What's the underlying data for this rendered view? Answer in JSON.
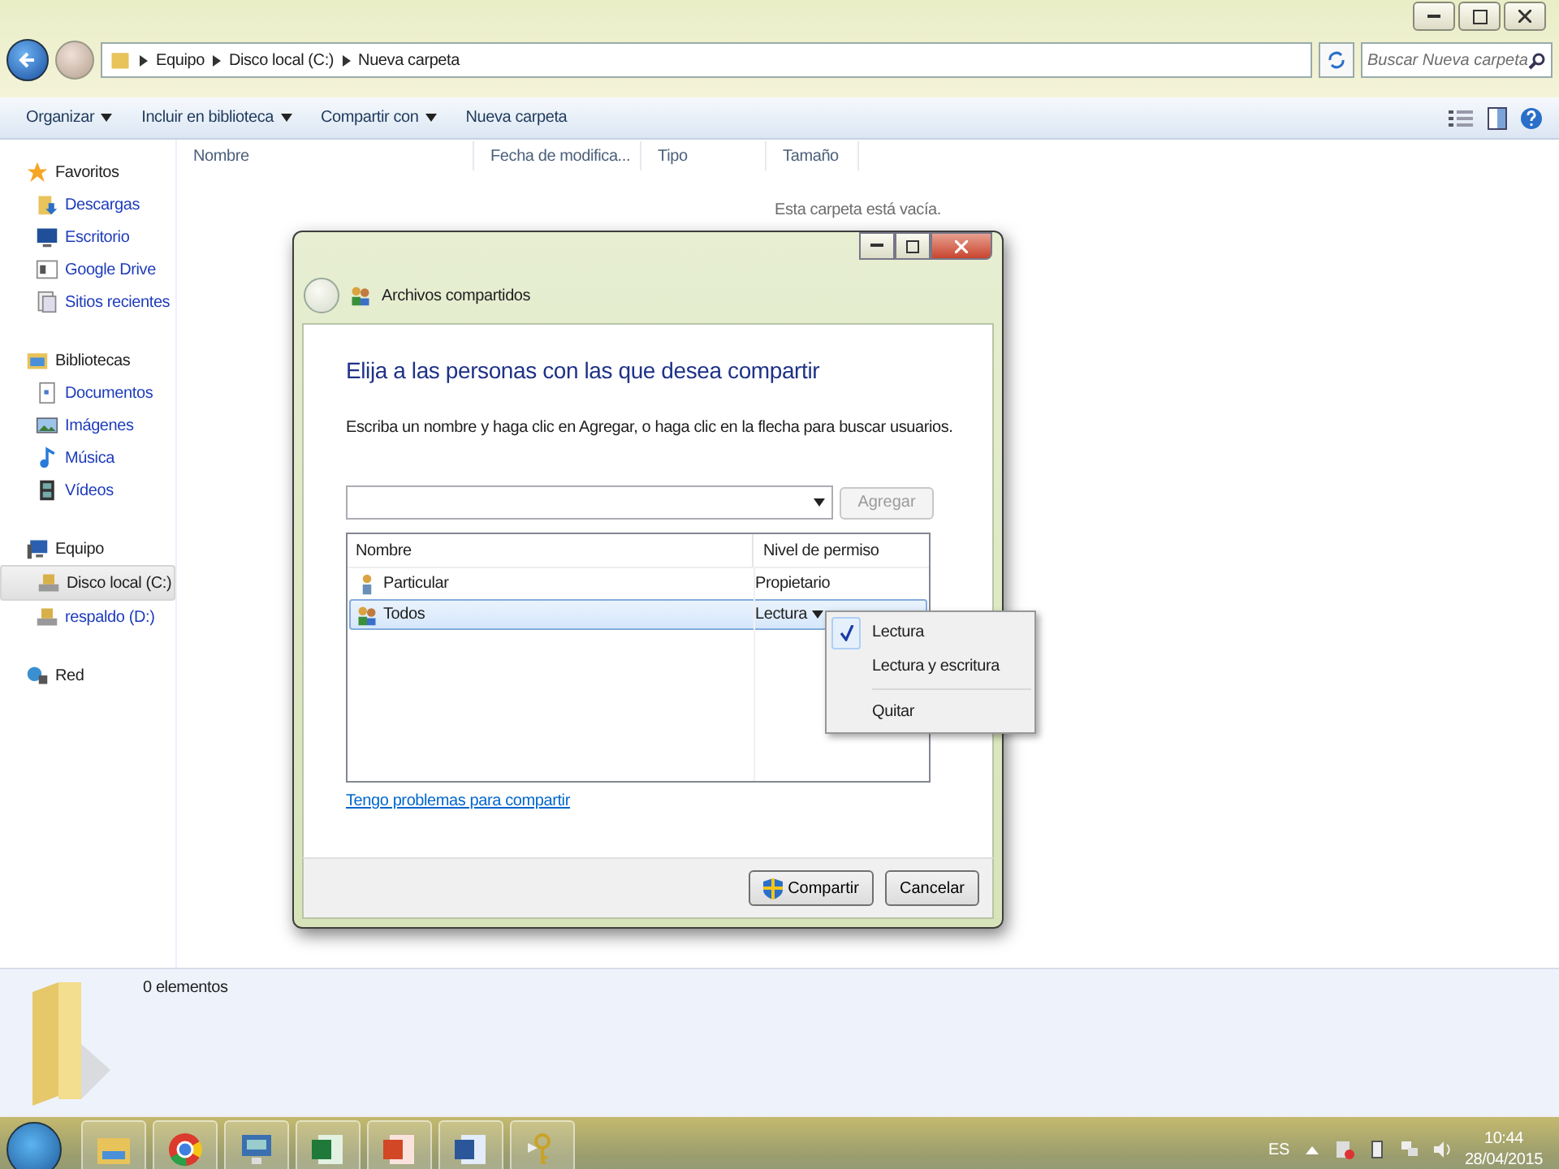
{
  "address_bar": {
    "breadcrumb": [
      "Equipo",
      "Disco local (C:)",
      "Nueva carpeta"
    ],
    "search": {
      "placeholder": "Buscar Nueva carpeta"
    }
  },
  "toolbar": {
    "items": [
      {
        "label": "Organizar",
        "has_menu": true
      },
      {
        "label": "Incluir en biblioteca",
        "has_menu": true
      },
      {
        "label": "Compartir con",
        "has_menu": true
      },
      {
        "label": "Nueva carpeta",
        "has_menu": false
      }
    ]
  },
  "sidebar": {
    "groups": [
      {
        "label": "Favoritos",
        "selected": false,
        "children": [
          {
            "label": "Descargas",
            "selected": false
          },
          {
            "label": "Escritorio",
            "selected": false
          },
          {
            "label": "Google Drive",
            "selected": false
          },
          {
            "label": "Sitios recientes",
            "selected": false
          }
        ]
      },
      {
        "label": "Bibliotecas",
        "selected": false,
        "children": [
          {
            "label": "Documentos",
            "selected": false
          },
          {
            "label": "Imágenes",
            "selected": false
          },
          {
            "label": "Música",
            "selected": false
          },
          {
            "label": "Vídeos",
            "selected": false
          }
        ]
      },
      {
        "label": "Equipo",
        "selected": false,
        "children": [
          {
            "label": "Disco local (C:)",
            "selected": true
          },
          {
            "label": "respaldo (D:)",
            "selected": false
          }
        ]
      },
      {
        "label": "Red",
        "selected": false
      }
    ]
  },
  "file_list": {
    "columns": [
      "Nombre",
      "Fecha de modifica...",
      "Tipo",
      "Tamaño"
    ],
    "empty_message": "Esta carpeta está vacía."
  },
  "details_pane": {
    "count": "0 elementos"
  },
  "dialog": {
    "title": "Archivos compartidos",
    "heading": "Elija a las personas con las que desea compartir",
    "description": "Escriba un nombre y haga clic en Agregar, o haga clic en la flecha para buscar usuarios.",
    "add_button": {
      "label": "Agregar",
      "disabled": true
    },
    "table": {
      "columns": [
        "Nombre",
        "Nivel de permiso"
      ],
      "rows": [
        {
          "name": "Particular",
          "permission": "Propietario",
          "kind": "user",
          "selected": false,
          "has_menu": false
        },
        {
          "name": "Todos",
          "permission": "Lectura",
          "kind": "group",
          "selected": true,
          "has_menu": true
        }
      ]
    },
    "link": "Tengo problemas para compartir",
    "buttons": [
      {
        "label": "Compartir",
        "shield": true
      },
      {
        "label": "Cancelar",
        "shield": false
      }
    ]
  },
  "permission_menu": {
    "items": [
      {
        "label": "Lectura",
        "kind": "option",
        "checked": true
      },
      {
        "label": "Lectura y escritura",
        "kind": "option",
        "checked": false
      },
      {
        "label": "Quitar",
        "kind": "action",
        "checked": false
      }
    ]
  },
  "taskbar": {
    "language": "ES",
    "time": "10:44",
    "date": "28/04/2015"
  }
}
